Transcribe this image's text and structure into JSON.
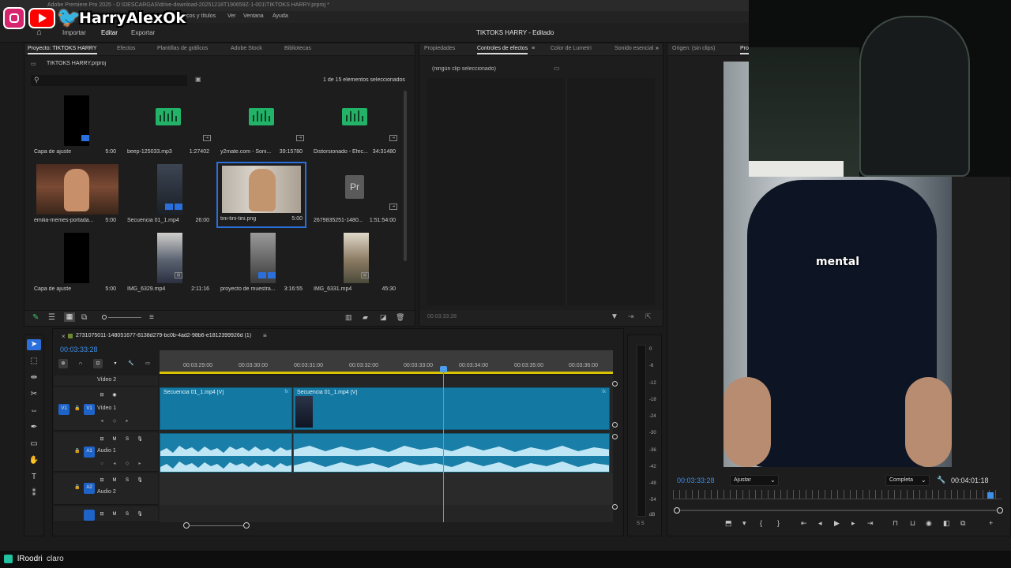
{
  "app": {
    "window_title": "Adobe Premiere Pro 2025 - D:\\DESCARGAS\\drive-download-20251218T190659Z-1-001\\TIKTOKS HARRY.prproj *",
    "menu": [
      "res",
      "Gráficos y títulos",
      "Ver",
      "Ventana",
      "Ayuda"
    ],
    "header_tabs": [
      "Importar",
      "Editar",
      "Exportar"
    ],
    "project_title": "TIKTOKS HARRY - Editado"
  },
  "overlay": {
    "streamer_handle": "HarryAlexOk",
    "caption": "mental"
  },
  "project_panel": {
    "tabs": [
      "Proyecto: TIKTOKS HARRY",
      "Efectos",
      "Plantillas de gráficos",
      "Adobe Stock",
      "Bibliotecas"
    ],
    "file": "TIKTOKS HARRY.prproj",
    "selection_status": "1 de 15 elementos seleccionados",
    "items": [
      {
        "name": "Capa de ajuste",
        "duration": "5:00"
      },
      {
        "name": "beep-125033.mp3",
        "duration": "1:27402"
      },
      {
        "name": "y2mate.com - Soni...",
        "duration": "39:15780"
      },
      {
        "name": "Distorsionado - Efec...",
        "duration": "34:31480"
      },
      {
        "name": "emilia-memes-portada...",
        "duration": "5:00"
      },
      {
        "name": "Secuencia 01_1.mp4",
        "duration": "26:00"
      },
      {
        "name": "tini-tini-tini.png",
        "duration": "5:00"
      },
      {
        "name": "2679835251-1480...",
        "duration": "1:51:54:00"
      },
      {
        "name": "Capa de ajuste",
        "duration": "5:00"
      },
      {
        "name": "IMG_6329.mp4",
        "duration": "2:11:16"
      },
      {
        "name": "proyecto de muestra...",
        "duration": "3:16:55"
      },
      {
        "name": "IMG_6331.mp4",
        "duration": "45:30"
      }
    ]
  },
  "effects_panel": {
    "tabs": [
      "Propiedades",
      "Controles de efectos",
      "Color de Lumetri",
      "Sonido esencial"
    ],
    "empty_label": "(ningún clip seleccionado)",
    "timecode": "00:03:33:28"
  },
  "timeline": {
    "sequence_name": "2731075011-148051677-8138d279-bc0b-4ad2-98b6-e1812399926d (1)",
    "timecode": "00:03:33:28",
    "ruler": [
      "00:03:29:00",
      "00:03:30:00",
      "00:03:31:00",
      "00:03:32:00",
      "00:03:33:00",
      "00:03:34:00",
      "00:03:35:00",
      "00:03:36:00"
    ],
    "tracks": {
      "video2": "Vídeo 2",
      "video1": "Vídeo 1",
      "audio1": "Audio 1",
      "audio2": "Audio 2",
      "v1_src": "V1",
      "v1": "V1",
      "a1": "A1",
      "a2": "A2"
    },
    "clips": [
      "Secuencia 01_1.mp4 [V]",
      "Secuencia 01_1.mp4 [V]"
    ],
    "meter_scale": [
      "0",
      "-6",
      "-12",
      "-18",
      "-24",
      "-30",
      "-36",
      "-42",
      "-48",
      "-54",
      "dB"
    ],
    "meter_footer": "S S"
  },
  "program_monitor": {
    "source_tab": "Origen: (sin clips)",
    "program_tab": "Pro",
    "timecode": "00:03:33:28",
    "fit": "Ajustar",
    "quality": "Completa",
    "duration": "00:04:01:18"
  },
  "chat": {
    "user": "lRoodri",
    "message": "claro"
  }
}
